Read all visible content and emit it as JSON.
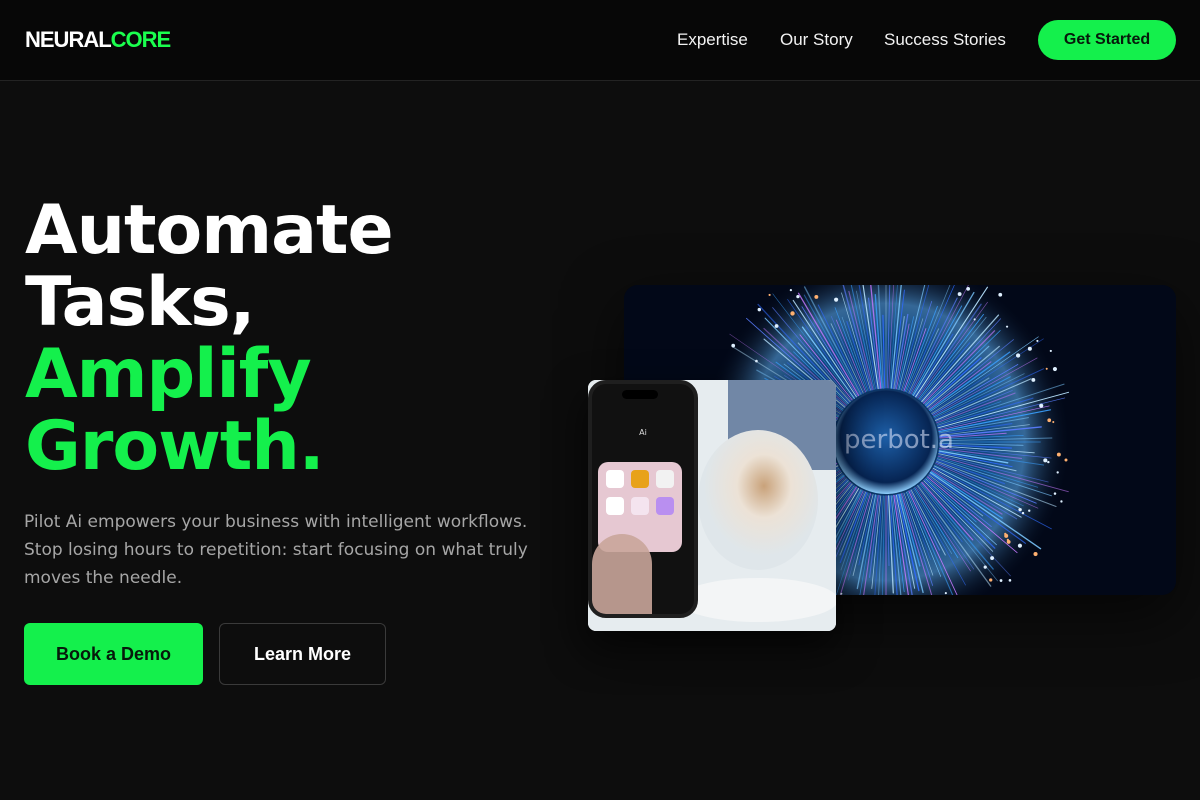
{
  "header": {
    "logo_part1": "NEURAL",
    "logo_part2": "CORE",
    "nav": [
      "Expertise",
      "Our Story",
      "Success Stories"
    ],
    "cta_label": "Get Started"
  },
  "hero": {
    "headline_lines": [
      "Automate",
      "Tasks,",
      "Amplify",
      "Growth."
    ],
    "description": "Pilot Ai empowers your business with intelligent workflows. Stop losing hours to repetition: start focusing on what truly moves the needle.",
    "primary_button": "Book a Demo",
    "secondary_button": "Learn More"
  },
  "visual": {
    "image_watermark": "perbot.a",
    "phone_screen_title": "Ai"
  },
  "colors": {
    "accent": "#14f04c",
    "background": "#0d0d0d",
    "header_background": "#070707",
    "muted_text": "#a6a6a6"
  }
}
